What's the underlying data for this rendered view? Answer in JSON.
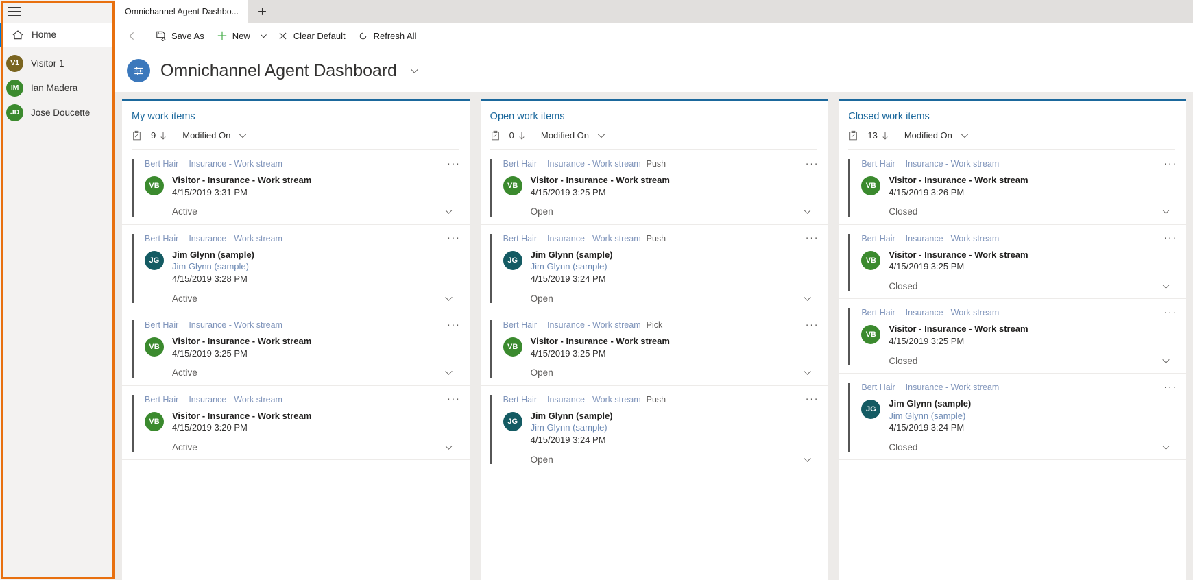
{
  "sidebar": {
    "hamburger_label": "Site map",
    "home": {
      "label": "Home",
      "icon": "home-icon"
    },
    "items": [
      {
        "initials": "V1",
        "label": "Visitor 1",
        "color": "#7a6520"
      },
      {
        "initials": "IM",
        "label": "Ian Madera",
        "color": "#3b8a2e"
      },
      {
        "initials": "JD",
        "label": "Jose Doucette",
        "color": "#3b8a2e"
      }
    ]
  },
  "tabs": {
    "active": "Omnichannel Agent Dashbo...",
    "new_tab_label": "+"
  },
  "commandbar": {
    "back_label": "Back",
    "save_as": "Save As",
    "new": "New",
    "clear_default": "Clear Default",
    "refresh_all": "Refresh All"
  },
  "page": {
    "title": "Omnichannel Agent Dashboard",
    "icon": "dashboard-icon",
    "caret": "chevron-down-icon"
  },
  "colors": {
    "accent": "#1b689c",
    "stream_title": "#1b689c",
    "card_bar": "#565656",
    "highlight": "#e8700f",
    "avatar_green": "#3b8a2e",
    "avatar_teal": "#145b63",
    "avatar_olive": "#7a6520"
  },
  "streams": [
    {
      "title": "My work items",
      "count": "9",
      "sort_label": "Modified On",
      "cards": [
        {
          "agent": "Bert Hair",
          "stream": "Insurance - Work stream",
          "mode": "",
          "initials": "VB",
          "avatar_color": "#3b8a2e",
          "name": "Visitor - Insurance - Work stream",
          "sub": "",
          "time": "4/15/2019 3:31 PM",
          "status": "Active"
        },
        {
          "agent": "Bert Hair",
          "stream": "Insurance - Work stream",
          "mode": "",
          "initials": "JG",
          "avatar_color": "#145b63",
          "name": "Jim Glynn (sample)",
          "sub": "Jim Glynn (sample)",
          "time": "4/15/2019 3:28 PM",
          "status": "Active"
        },
        {
          "agent": "Bert Hair",
          "stream": "Insurance - Work stream",
          "mode": "",
          "initials": "VB",
          "avatar_color": "#3b8a2e",
          "name": "Visitor - Insurance - Work stream",
          "sub": "",
          "time": "4/15/2019 3:25 PM",
          "status": "Active"
        },
        {
          "agent": "Bert Hair",
          "stream": "Insurance - Work stream",
          "mode": "",
          "initials": "VB",
          "avatar_color": "#3b8a2e",
          "name": "Visitor - Insurance - Work stream",
          "sub": "",
          "time": "4/15/2019 3:20 PM",
          "status": "Active"
        }
      ]
    },
    {
      "title": "Open work items",
      "count": "0",
      "sort_label": "Modified On",
      "cards": [
        {
          "agent": "Bert Hair",
          "stream": "Insurance - Work stream",
          "mode": "Push",
          "initials": "VB",
          "avatar_color": "#3b8a2e",
          "name": "Visitor - Insurance - Work stream",
          "sub": "",
          "time": "4/15/2019 3:25 PM",
          "status": "Open"
        },
        {
          "agent": "Bert Hair",
          "stream": "Insurance - Work stream",
          "mode": "Push",
          "initials": "JG",
          "avatar_color": "#145b63",
          "name": "Jim Glynn (sample)",
          "sub": "Jim Glynn (sample)",
          "time": "4/15/2019 3:24 PM",
          "status": "Open"
        },
        {
          "agent": "Bert Hair",
          "stream": "Insurance - Work stream",
          "mode": "Pick",
          "initials": "VB",
          "avatar_color": "#3b8a2e",
          "name": "Visitor - Insurance - Work stream",
          "sub": "",
          "time": "4/15/2019 3:25 PM",
          "status": "Open"
        },
        {
          "agent": "Bert Hair",
          "stream": "Insurance - Work stream",
          "mode": "Push",
          "initials": "JG",
          "avatar_color": "#145b63",
          "name": "Jim Glynn (sample)",
          "sub": "Jim Glynn (sample)",
          "time": "4/15/2019 3:24 PM",
          "status": "Open"
        }
      ]
    },
    {
      "title": "Closed work items",
      "count": "13",
      "sort_label": "Modified On",
      "cards": [
        {
          "agent": "Bert Hair",
          "stream": "Insurance - Work stream",
          "mode": "",
          "initials": "VB",
          "avatar_color": "#3b8a2e",
          "name": "Visitor - Insurance - Work stream",
          "sub": "",
          "time": "4/15/2019 3:26 PM",
          "status": "Closed"
        },
        {
          "agent": "Bert Hair",
          "stream": "Insurance - Work stream",
          "mode": "",
          "initials": "VB",
          "avatar_color": "#3b8a2e",
          "name": "Visitor - Insurance - Work stream",
          "sub": "",
          "time": "4/15/2019 3:25 PM",
          "status": "Closed"
        },
        {
          "agent": "Bert Hair",
          "stream": "Insurance - Work stream",
          "mode": "",
          "initials": "VB",
          "avatar_color": "#3b8a2e",
          "name": "Visitor - Insurance - Work stream",
          "sub": "",
          "time": "4/15/2019 3:25 PM",
          "status": "Closed"
        },
        {
          "agent": "Bert Hair",
          "stream": "Insurance - Work stream",
          "mode": "",
          "initials": "JG",
          "avatar_color": "#145b63",
          "name": "Jim Glynn (sample)",
          "sub": "Jim Glynn (sample)",
          "time": "4/15/2019 3:24 PM",
          "status": "Closed"
        }
      ]
    }
  ]
}
